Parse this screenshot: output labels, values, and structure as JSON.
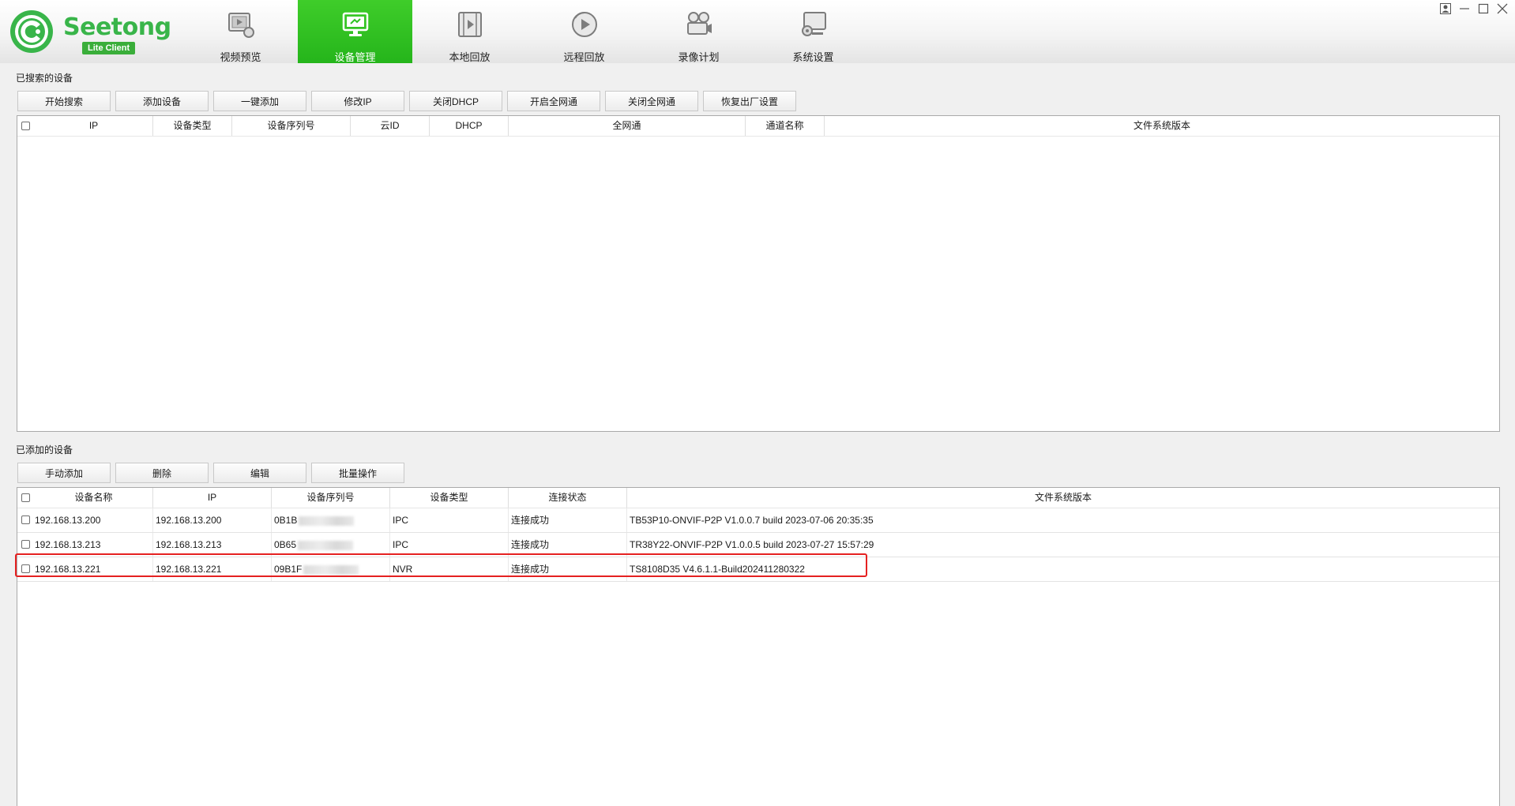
{
  "app": {
    "logo_name": "Seetong",
    "logo_badge": "Lite Client",
    "brand_color": "#39b54a",
    "active_tab_color": "#2fc222"
  },
  "nav": [
    {
      "label": "视频预览",
      "icon": "video-preview-icon"
    },
    {
      "label": "设备管理",
      "icon": "device-management-icon",
      "active": true
    },
    {
      "label": "本地回放",
      "icon": "local-playback-icon"
    },
    {
      "label": "远程回放",
      "icon": "remote-playback-icon"
    },
    {
      "label": "录像计划",
      "icon": "record-schedule-icon"
    },
    {
      "label": "系统设置",
      "icon": "system-settings-icon"
    }
  ],
  "window_controls": [
    "user-icon",
    "minimize-icon",
    "maximize-icon",
    "close-icon"
  ],
  "searched": {
    "title": "已搜索的设备",
    "buttons": [
      "开始搜索",
      "添加设备",
      "一键添加",
      "修改IP",
      "关闭DHCP",
      "开启全网通",
      "关闭全网通",
      "恢复出厂设置"
    ],
    "columns": [
      "IP",
      "设备类型",
      "设备序列号",
      "云ID",
      "DHCP",
      "全网通",
      "通道名称",
      "文件系统版本"
    ],
    "rows": []
  },
  "added": {
    "title": "已添加的设备",
    "buttons": [
      "手动添加",
      "删除",
      "编辑",
      "批量操作"
    ],
    "columns": [
      "设备名称",
      "IP",
      "设备序列号",
      "设备类型",
      "连接状态",
      "文件系统版本"
    ],
    "rows": [
      {
        "name": "192.168.13.200",
        "ip": "192.168.13.200",
        "serial": "0B1B",
        "type": "IPC",
        "status": "连接成功",
        "firmware": "TB53P10-ONVIF-P2P V1.0.0.7 build 2023-07-06 20:35:35",
        "checked": false,
        "highlighted": false
      },
      {
        "name": "192.168.13.213",
        "ip": "192.168.13.213",
        "serial": "0B65",
        "type": "IPC",
        "status": "连接成功",
        "firmware": "TR38Y22-ONVIF-P2P V1.0.0.5 build 2023-07-27 15:57:29",
        "checked": false,
        "highlighted": false
      },
      {
        "name": "192.168.13.221",
        "ip": "192.168.13.221",
        "serial": "09B1F",
        "type": "NVR",
        "status": "连接成功",
        "firmware": "TS8108D35 V4.6.1.1-Build202411280322",
        "checked": false,
        "highlighted": true
      }
    ],
    "highlight_color": "#e52121"
  }
}
